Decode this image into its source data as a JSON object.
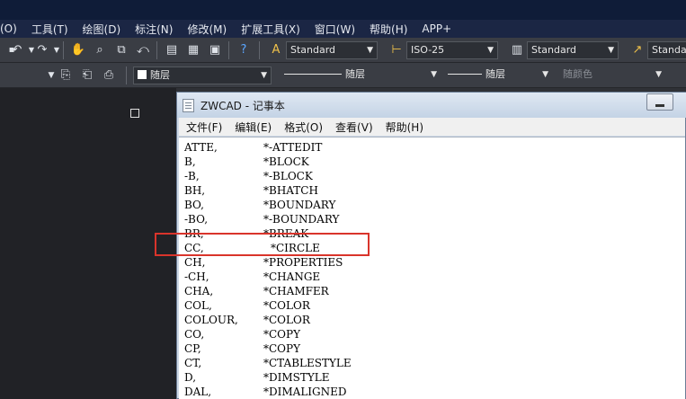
{
  "app_menu": [
    "(O)",
    "工具(T)",
    "绘图(D)",
    "标注(N)",
    "修改(M)",
    "扩展工具(X)",
    "窗口(W)",
    "帮助(H)",
    "APP+"
  ],
  "toolbar": {
    "text_style": "Standard",
    "dim_style": "ISO-25",
    "table_style": "Standard",
    "mleader_style": "Standar",
    "layer": "随层",
    "linetype_label": "随层",
    "lineweight_label": "随层",
    "plot_color": "随颜色"
  },
  "notepad": {
    "title": "ZWCAD - 记事本",
    "menu": [
      "文件(F)",
      "编辑(E)",
      "格式(O)",
      "查看(V)",
      "帮助(H)"
    ],
    "lines": [
      {
        "alias": "ATTE,",
        "command": "*-ATTEDIT"
      },
      {
        "alias": "B,",
        "command": "*BLOCK"
      },
      {
        "alias": "-B,",
        "command": "*-BLOCK"
      },
      {
        "alias": "BH,",
        "command": "*BHATCH"
      },
      {
        "alias": "BO,",
        "command": "*BOUNDARY"
      },
      {
        "alias": "-BO,",
        "command": "*-BOUNDARY"
      },
      {
        "alias": "BR,",
        "command": "*BREAK"
      },
      {
        "alias": "CC,",
        "command": "*CIRCLE"
      },
      {
        "alias": "CH,",
        "command": "*PROPERTIES"
      },
      {
        "alias": "-CH,",
        "command": "*CHANGE"
      },
      {
        "alias": "CHA,",
        "command": "*CHAMFER"
      },
      {
        "alias": "COL,",
        "command": "*COLOR"
      },
      {
        "alias": "COLOUR,",
        "command": "*COLOR"
      },
      {
        "alias": "CO,",
        "command": "*COPY"
      },
      {
        "alias": "CP,",
        "command": "*COPY"
      },
      {
        "alias": "CT,",
        "command": "*CTABLESTYLE"
      },
      {
        "alias": "D,",
        "command": "*DIMSTYLE"
      },
      {
        "alias": "DAL,",
        "command": "*DIMALIGNED"
      }
    ],
    "highlighted_line": "CC,",
    "highlight_color": "#d9342b"
  }
}
